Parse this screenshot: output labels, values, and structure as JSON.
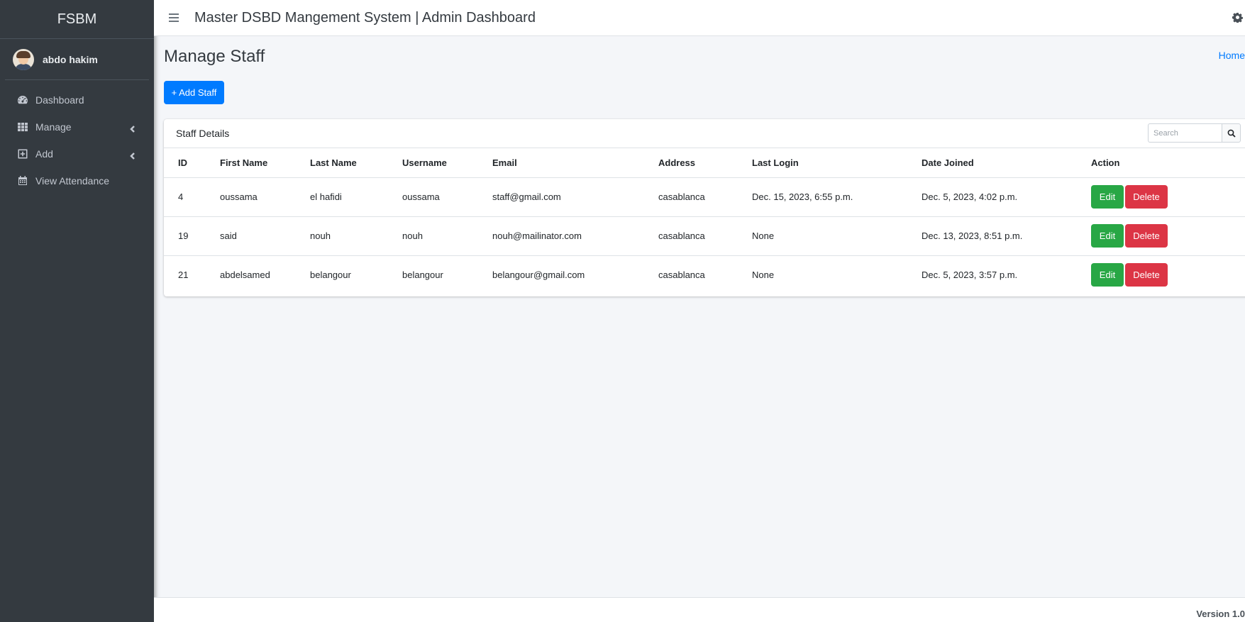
{
  "sidebar": {
    "brand": "FSBM",
    "user": "abdo hakim",
    "items": [
      {
        "label": "Dashboard",
        "icon": "tachometer-icon"
      },
      {
        "label": "Manage",
        "icon": "grid-icon"
      },
      {
        "label": "Add",
        "icon": "plus-square-icon"
      },
      {
        "label": "View Attendance",
        "icon": "calendar-icon"
      }
    ]
  },
  "header": {
    "title": "Master DSBD Mangement System | Admin Dashboard"
  },
  "page": {
    "title": "Manage Staff",
    "breadcrumb": "Home",
    "add_button": "+ Add Staff"
  },
  "card": {
    "title": "Staff Details",
    "search_placeholder": "Search"
  },
  "table": {
    "columns": [
      "ID",
      "First Name",
      "Last Name",
      "Username",
      "Email",
      "Address",
      "Last Login",
      "Date Joined",
      "Action"
    ],
    "rows": [
      {
        "id": "4",
        "first": "oussama",
        "last": "el hafidi",
        "username": "oussama",
        "email": "staff@gmail.com",
        "address": "casablanca",
        "last_login": "Dec. 15, 2023, 6:55 p.m.",
        "joined": "Dec. 5, 2023, 4:02 p.m."
      },
      {
        "id": "19",
        "first": "said",
        "last": "nouh",
        "username": "nouh",
        "email": "nouh@mailinator.com",
        "address": "casablanca",
        "last_login": "None",
        "joined": "Dec. 13, 2023, 8:51 p.m."
      },
      {
        "id": "21",
        "first": "abdelsamed",
        "last": "belangour",
        "username": "belangour",
        "email": "belangour@gmail.com",
        "address": "casablanca",
        "last_login": "None",
        "joined": "Dec. 5, 2023, 3:57 p.m."
      }
    ],
    "edit_label": "Edit",
    "delete_label": "Delete"
  },
  "footer": {
    "version": "Version 1.0"
  },
  "colors": {
    "sidebar_bg": "#343a40",
    "primary": "#007bff",
    "success": "#28a745",
    "danger": "#dc3545"
  }
}
